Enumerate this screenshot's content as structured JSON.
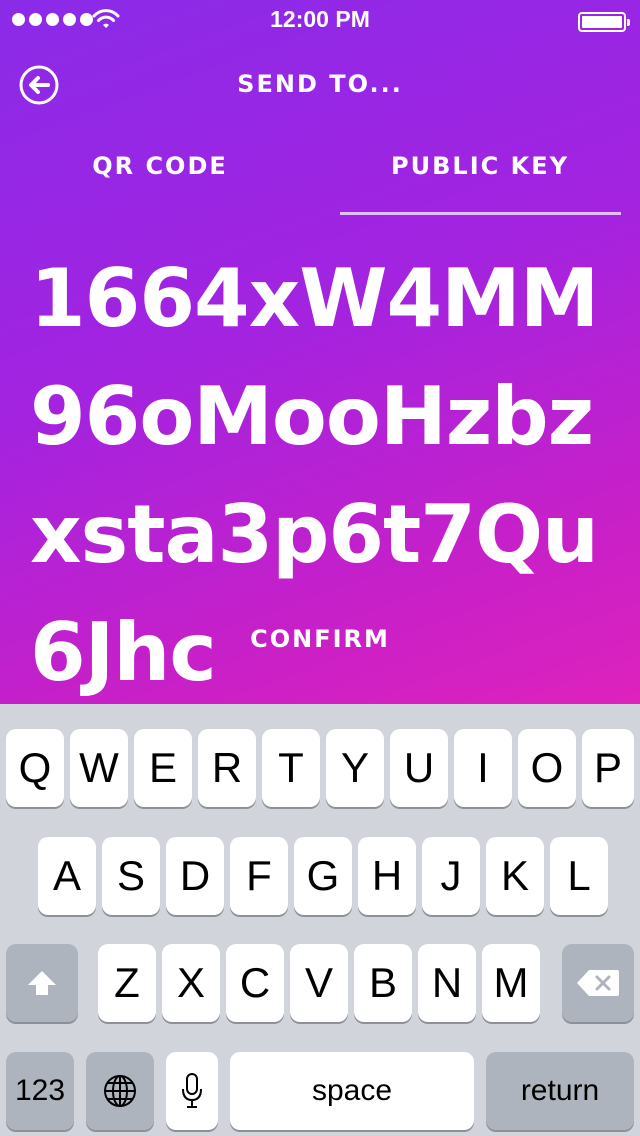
{
  "status_bar": {
    "time": "12:00 PM",
    "signal_icon": "signal-dots-icon",
    "wifi_icon": "wifi-icon",
    "battery_icon": "battery-icon"
  },
  "header": {
    "back_icon": "back-arrow-circle-icon",
    "title": "SEND TO..."
  },
  "tabs": [
    {
      "label": "QR CODE",
      "active": false
    },
    {
      "label": "PUBLIC KEY",
      "active": true
    }
  ],
  "public_key_value": "1664xW4MM96oMooHzbzxsta3p6t7Qu6Jhc",
  "confirm_label": "CONFIRM",
  "colors": {
    "gradient_start": "#8a2be8",
    "gradient_end": "#de22bd",
    "keyboard_bg": "#d1d5db"
  },
  "keyboard": {
    "row1": [
      "Q",
      "W",
      "E",
      "R",
      "T",
      "Y",
      "U",
      "I",
      "O",
      "P"
    ],
    "row2": [
      "A",
      "S",
      "D",
      "F",
      "G",
      "H",
      "J",
      "K",
      "L"
    ],
    "row3": [
      "Z",
      "X",
      "C",
      "V",
      "B",
      "N",
      "M"
    ],
    "shift_icon": "shift-arrow-icon",
    "delete_icon": "backspace-icon",
    "numbers_label": "123",
    "globe_icon": "globe-icon",
    "mic_icon": "microphone-icon",
    "space_label": "space",
    "return_label": "return"
  }
}
